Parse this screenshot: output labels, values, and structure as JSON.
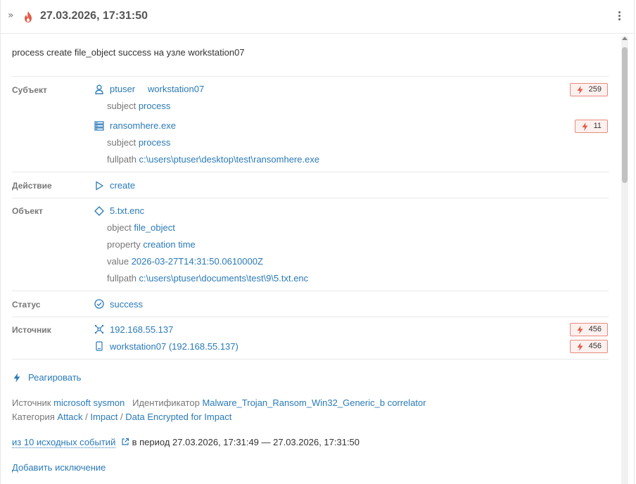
{
  "header": {
    "expand_glyph": "»",
    "title": "27.03.2026, 17:31:50",
    "fire_icon": "fire-icon",
    "menu_icon": "more-vertical-icon"
  },
  "summary": "process create file_object success на узле workstation07",
  "subject": {
    "label": "Субъект",
    "user": "ptuser",
    "host": "workstation07",
    "user_badge": "259",
    "user_type_key": "subject",
    "user_type_val": "process",
    "process": "ransomhere.exe",
    "process_badge": "11",
    "process_type_key": "subject",
    "process_type_val": "process",
    "fullpath_key": "fullpath",
    "fullpath_val": "c:\\users\\ptuser\\desktop\\test\\ransomhere.exe"
  },
  "action": {
    "label": "Действие",
    "value": "create"
  },
  "object": {
    "label": "Объект",
    "name": "5.txt.enc",
    "object_key": "object",
    "object_val": "file_object",
    "property_key": "property",
    "property_val": "creation time",
    "value_key": "value",
    "value_val": "2026-03-27T14:31:50.0610000Z",
    "fullpath_key": "fullpath",
    "fullpath_val": "c:\\users\\ptuser\\documents\\test\\9\\5.txt.enc"
  },
  "status": {
    "label": "Статус",
    "value": "success"
  },
  "source": {
    "label": "Источник",
    "ip": "192.168.55.137",
    "ip_badge": "456",
    "host": "workstation07 (192.168.55.137)",
    "host_badge": "456"
  },
  "react": {
    "label": "Реагировать"
  },
  "meta": {
    "source_key": "Источник",
    "source_val": "microsoft sysmon",
    "id_key": "Идентификатор",
    "id_val": "Malware_Trojan_Ransom_Win32_Generic_b correlator",
    "category_key": "Категория",
    "cat1": "Attack",
    "sep": "/",
    "cat2": "Impact",
    "cat3": "Data Encrypted for Impact"
  },
  "events": {
    "link": "из 10 исходных событий",
    "period": "в период 27.03.2026, 17:31:49 — 27.03.2026, 17:31:50"
  },
  "add_exception": "Добавить исключение",
  "colors": {
    "accent": "#2a7ab8",
    "danger": "#e25c4a",
    "badge_bg": "#fdf1ef"
  }
}
